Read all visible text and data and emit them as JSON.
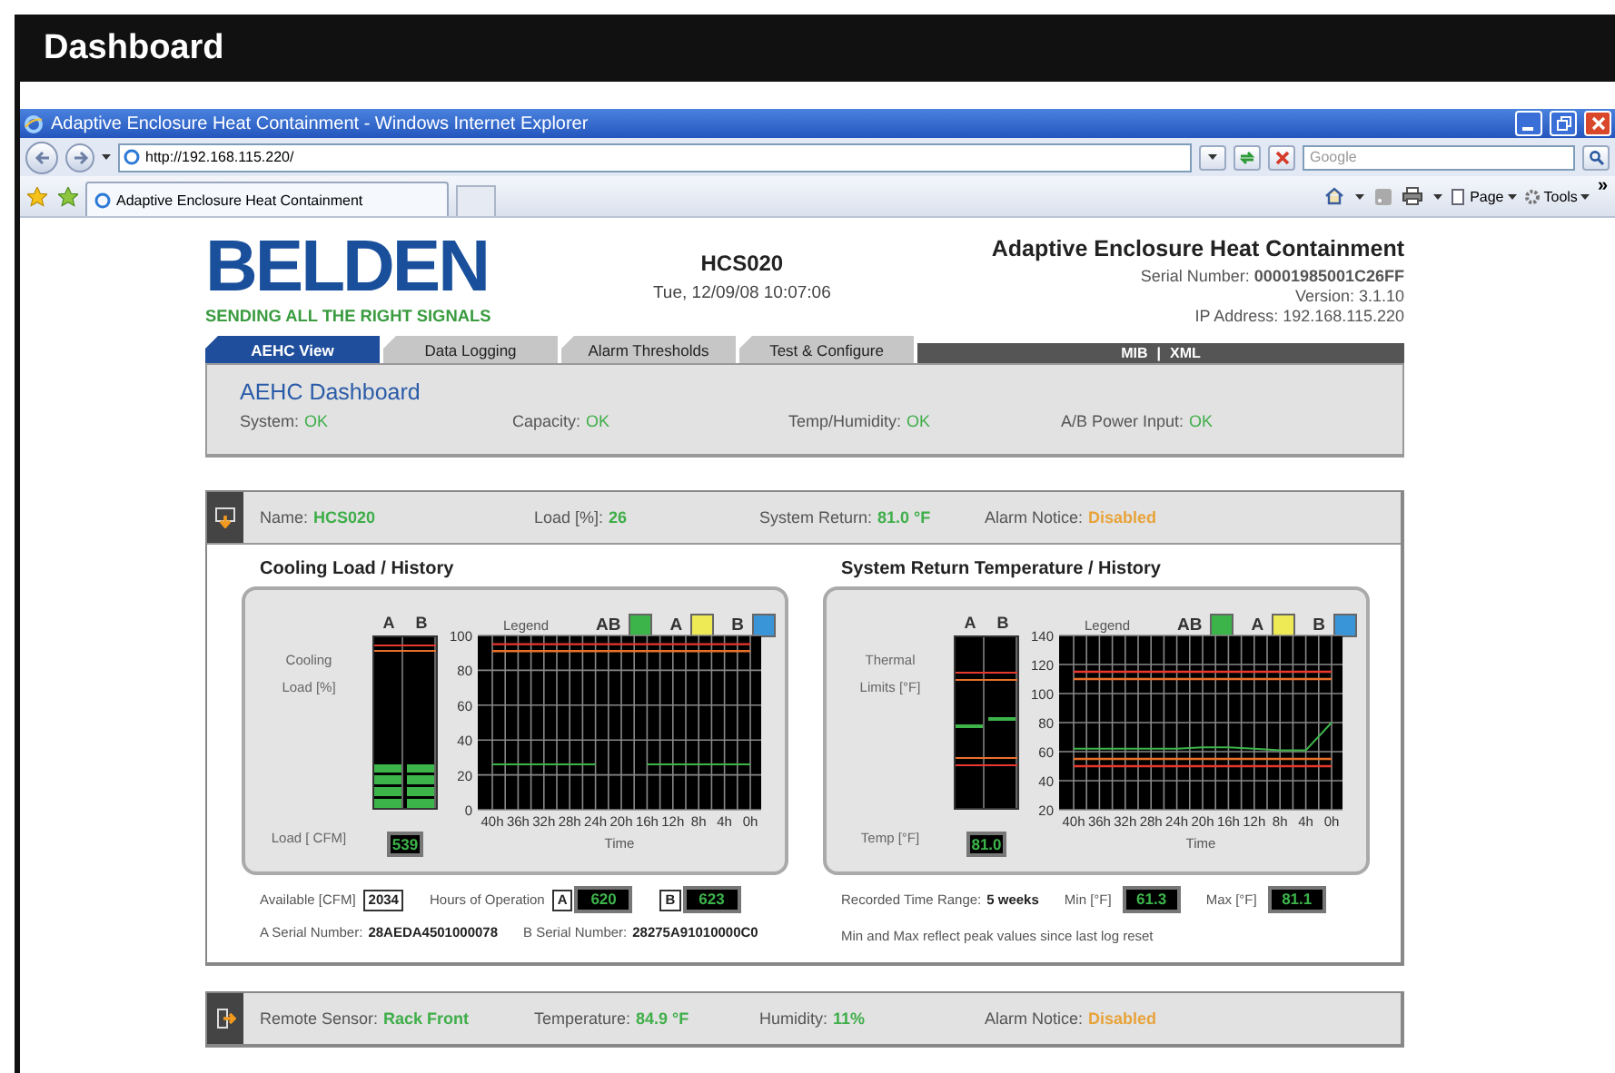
{
  "header": {
    "title": "Dashboard"
  },
  "browser": {
    "title": "Adaptive Enclosure Heat Containment - Windows Internet Explorer",
    "address": "http://192.168.115.220/",
    "search_placeholder": "Google",
    "tabs": [
      {
        "label": "Adaptive Enclosure Heat Containment",
        "selected": true
      }
    ],
    "toolbar": [
      "Page",
      "Tools"
    ],
    "more": "»"
  },
  "page": {
    "logo": {
      "name": "BELDEN",
      "tagline": "SENDING ALL THE RIGHT SIGNALS"
    },
    "device": {
      "name": "HCS020",
      "datetime": "Tue, 12/09/08 10:07:06"
    },
    "product": {
      "title": "Adaptive Enclosure Heat Containment",
      "serial_label": "Serial Number:",
      "serial": "00001985001C26FF",
      "version": "Version: 3.1.10",
      "ip": "IP Address: 192.168.115.220"
    },
    "nav_tabs": [
      {
        "label": "AEHC View",
        "selected": true
      },
      {
        "label": "Data Logging",
        "selected": false
      },
      {
        "label": "Alarm Thresholds",
        "selected": false
      },
      {
        "label": "Test & Configure",
        "selected": false
      }
    ],
    "links": [
      "MIB",
      "XML"
    ],
    "link_separator": "|",
    "dashboard": {
      "title": "AEHC Dashboard",
      "statuses": [
        {
          "label": "System:",
          "value": "OK"
        },
        {
          "label": "Capacity:",
          "value": "OK"
        },
        {
          "label": "Temp/Humidity:",
          "value": "OK"
        },
        {
          "label": "A/B Power Input:",
          "value": "OK"
        }
      ]
    },
    "unit": {
      "fields": [
        {
          "label": "Name:",
          "value": "HCS020",
          "color": "#3fae49"
        },
        {
          "label": "Load [%]:",
          "value": "26",
          "color": "#3fae49"
        },
        {
          "label": "System Return:",
          "value": "81.0 °F",
          "color": "#3fae49"
        },
        {
          "label": "Alarm Notice:",
          "value": "Disabled",
          "color": "#e8a33a"
        }
      ],
      "panels": [
        {
          "title": "Cooling Load / History",
          "meter_labels": [
            "Cooling",
            "Load [%]"
          ],
          "kind": "segments",
          "meter": [
            {
              "label": "A",
              "level": 0.26
            },
            {
              "label": "B",
              "level": 0.26
            }
          ],
          "legend_title": "Legend",
          "legend": [
            {
              "label": "AB",
              "color": "#3cb44a"
            },
            {
              "label": "A",
              "color": "#eeea55"
            },
            {
              "label": "B",
              "color": "#3a95d8"
            }
          ],
          "readout_label": "Load [ CFM]",
          "readout": "539",
          "chart_data": {
            "type": "line",
            "xlabel": "Time",
            "categories": [
              "40h",
              "36h",
              "32h",
              "28h",
              "24h",
              "20h",
              "16h",
              "12h",
              "8h",
              "4h",
              "0h"
            ],
            "series": [
              {
                "color": "#3cb44a",
                "values": [
                  26,
                  26,
                  26,
                  26,
                  26,
                  null,
                  26,
                  26,
                  26,
                  26,
                  26
                ]
              },
              {
                "color": "#e8382f",
                "values": [
                  95,
                  95,
                  95,
                  95,
                  95,
                  95,
                  95,
                  95,
                  95,
                  95,
                  95
                ]
              },
              {
                "color": "#e8702a",
                "values": [
                  91,
                  91,
                  91,
                  91,
                  91,
                  91,
                  91,
                  91,
                  91,
                  91,
                  91
                ]
              }
            ],
            "ylim": [
              0,
              100
            ],
            "yticks": [
              0,
              20,
              40,
              60,
              80,
              100
            ],
            "grid": true
          },
          "info": [
            [
              {
                "kind": "label",
                "text": "Available [CFM]"
              },
              {
                "kind": "box",
                "text": "2034"
              },
              {
                "kind": "label",
                "text": "Hours of Operation"
              },
              {
                "kind": "box",
                "text": "A"
              },
              {
                "kind": "readout",
                "text": "620"
              },
              {
                "kind": "box",
                "text": "B"
              },
              {
                "kind": "readout",
                "text": "623"
              }
            ],
            [
              {
                "kind": "label",
                "text": "A Serial Number:"
              },
              {
                "kind": "value",
                "text": "28AEDA4501000078"
              },
              {
                "kind": "label",
                "text": "B Serial Number:"
              },
              {
                "kind": "value",
                "text": "28275A91010000C0"
              }
            ]
          ]
        },
        {
          "title": "System Return Temperature / History",
          "meter_labels": [
            "Thermal",
            "Limits [°F]"
          ],
          "kind": "marker",
          "meter": [
            {
              "label": "A",
              "level": 0.47
            },
            {
              "label": "B",
              "level": 0.51
            }
          ],
          "legend_title": "Legend",
          "legend": [
            {
              "label": "AB",
              "color": "#3cb44a"
            },
            {
              "label": "A",
              "color": "#eeea55"
            },
            {
              "label": "B",
              "color": "#3a95d8"
            }
          ],
          "readout_label": "Temp [°F]",
          "readout": "81.0",
          "chart_data": {
            "type": "line",
            "xlabel": "Time",
            "categories": [
              "40h",
              "36h",
              "32h",
              "28h",
              "24h",
              "20h",
              "16h",
              "12h",
              "8h",
              "4h",
              "0h"
            ],
            "series": [
              {
                "color": "#3cb44a",
                "values": [
                  62,
                  62,
                  62,
                  62,
                  62,
                  63,
                  63,
                  62,
                  61,
                  61,
                  80
                ]
              },
              {
                "color": "#e8382f",
                "values": [
                  115,
                  115,
                  115,
                  115,
                  115,
                  115,
                  115,
                  115,
                  115,
                  115,
                  115
                ]
              },
              {
                "color": "#e8702a",
                "values": [
                  110,
                  110,
                  110,
                  110,
                  110,
                  110,
                  110,
                  110,
                  110,
                  110,
                  110
                ]
              },
              {
                "color": "#e8702a",
                "values": [
                  55,
                  55,
                  55,
                  55,
                  55,
                  55,
                  55,
                  55,
                  55,
                  55,
                  55
                ]
              },
              {
                "color": "#e8382f",
                "values": [
                  50,
                  50,
                  50,
                  50,
                  50,
                  50,
                  50,
                  50,
                  50,
                  50,
                  50
                ]
              }
            ],
            "ylim": [
              20,
              140
            ],
            "yticks": [
              20,
              40,
              60,
              80,
              100,
              120,
              140
            ],
            "grid": true
          },
          "info": [
            [
              {
                "kind": "label",
                "text": "Recorded Time Range:"
              },
              {
                "kind": "value",
                "text": "5 weeks"
              },
              {
                "kind": "label",
                "text": "Min [°F]"
              },
              {
                "kind": "readout",
                "text": "61.3"
              },
              {
                "kind": "label",
                "text": "Max [°F]"
              },
              {
                "kind": "readout",
                "text": "81.1"
              }
            ],
            [
              {
                "kind": "note",
                "text": "Min and Max reflect peak values since last log reset"
              }
            ]
          ]
        }
      ]
    },
    "sensor": {
      "fields": [
        {
          "label": "Remote Sensor:",
          "value": "Rack Front",
          "color": "#3fae49"
        },
        {
          "label": "Temperature:",
          "value": "84.9 °F",
          "color": "#3fae49"
        },
        {
          "label": "Humidity:",
          "value": "11%",
          "color": "#3fae49"
        },
        {
          "label": "Alarm Notice:",
          "value": "Disabled",
          "color": "#e8a33a"
        }
      ]
    }
  }
}
